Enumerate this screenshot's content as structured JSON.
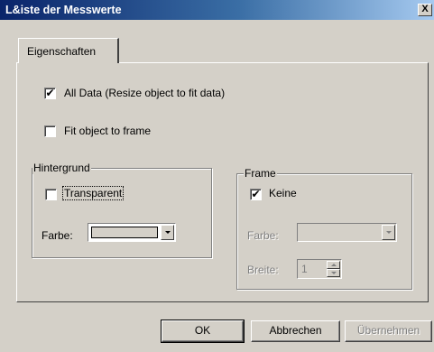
{
  "window": {
    "title": "L&iste der Messwerte",
    "close_label": "X"
  },
  "tabs": [
    {
      "label": "Eigenschaften"
    }
  ],
  "options": {
    "all_data": {
      "label": "All Data (Resize object to fit data)",
      "checked": true,
      "mark": "✔"
    },
    "fit_object": {
      "label": "Fit object to frame",
      "checked": false,
      "mark": ""
    }
  },
  "hintergrund": {
    "title": "Hintergrund",
    "transparent": {
      "label": "Transparent",
      "checked": false,
      "mark": ""
    },
    "farbe_label": "Farbe:"
  },
  "frame": {
    "title": "Frame",
    "keine": {
      "label": "Keine",
      "checked": true,
      "mark": "✔"
    },
    "farbe_label": "Farbe:",
    "breite_label": "Breite:",
    "breite_value": "1"
  },
  "buttons": {
    "ok": "OK",
    "cancel": "Abbrechen",
    "apply": "Übernehmen"
  },
  "colors": {
    "title_start": "#0a246a",
    "title_end": "#a6caf0",
    "face": "#d4d0c8",
    "disabled": "#808080"
  }
}
